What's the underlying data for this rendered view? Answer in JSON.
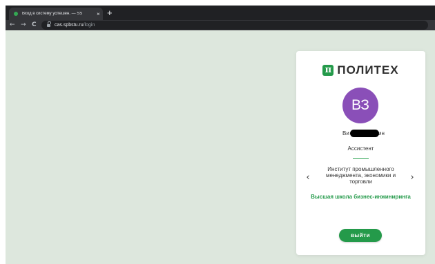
{
  "browser": {
    "tab": {
      "title": "Вход в систему успешен. — SS",
      "favicon": "green-dot-icon",
      "close_glyph": "×"
    },
    "new_tab_glyph": "+",
    "nav": {
      "back": "←",
      "forward": "→",
      "reload": "C"
    },
    "address": {
      "host": "cas.spbstu.ru",
      "path": "/login"
    }
  },
  "card": {
    "logo_mark": "π",
    "logo_text": "ПОЛИТЕХ",
    "avatar_initials": "ВЗ",
    "username_prefix": "Ви",
    "username_suffix": "ин",
    "role": "Ассистент",
    "institute": "Институт промышленного менеджмента, экономики и торговли",
    "prev_glyph": "‹",
    "next_glyph": "›",
    "school": "Высшая школа бизнес-инжиниринга",
    "logout_label": "выйти"
  },
  "colors": {
    "accent": "#249a4a",
    "avatar": "#8a4fb8",
    "page_bg": "#dde7dd"
  }
}
